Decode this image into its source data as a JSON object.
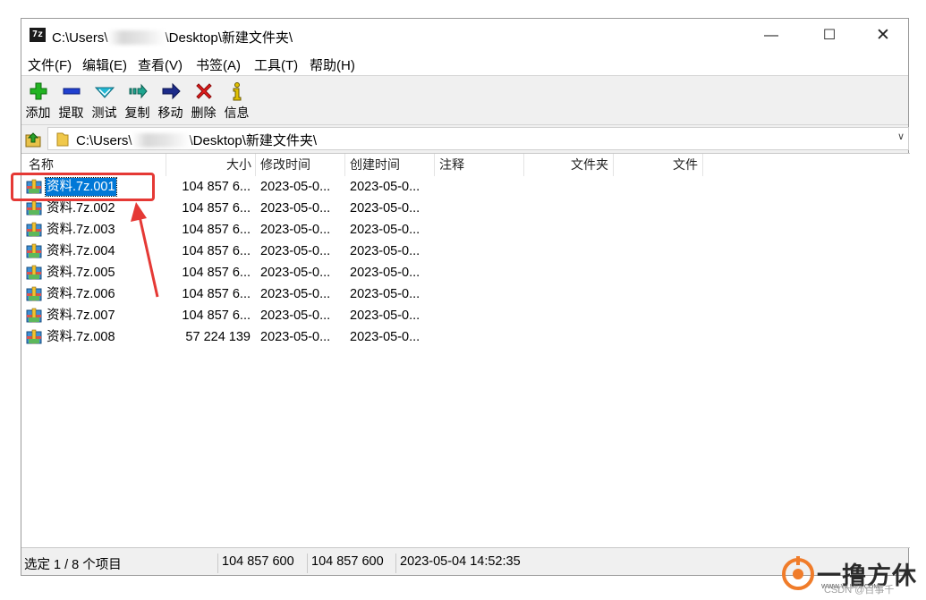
{
  "window": {
    "title_prefix": "C:\\Users\\",
    "title_suffix": "\\Desktop\\新建文件夹\\",
    "app_icon_text": "7z",
    "controls": {
      "minimize": "—",
      "maximize": "☐",
      "close": "✕"
    }
  },
  "menu": [
    "文件(F)",
    "编辑(E)",
    "查看(V)",
    "书签(A)",
    "工具(T)",
    "帮助(H)"
  ],
  "toolbar": [
    {
      "label": "添加",
      "icon": "add-plus-icon",
      "color": "#1ea81e"
    },
    {
      "label": "提取",
      "icon": "extract-minus-icon",
      "color": "#1a3bc7"
    },
    {
      "label": "测试",
      "icon": "test-check-icon",
      "color": "#19a9c4"
    },
    {
      "label": "复制",
      "icon": "copy-arrow-icon",
      "color": "#1c9c8c"
    },
    {
      "label": "移动",
      "icon": "move-arrow-icon",
      "color": "#1c2b8a"
    },
    {
      "label": "删除",
      "icon": "delete-x-icon",
      "color": "#e01818"
    },
    {
      "label": "信息",
      "icon": "info-icon",
      "color": "#d8b800"
    }
  ],
  "address": {
    "prefix": "C:\\Users\\",
    "suffix": "\\Desktop\\新建文件夹\\"
  },
  "columns": [
    "名称",
    "大小",
    "修改时间",
    "创建时间",
    "注释",
    "文件夹",
    "文件"
  ],
  "files": [
    {
      "name": "资料.7z.001",
      "size": "104 857 6...",
      "modified": "2023-05-0...",
      "created": "2023-05-0...",
      "selected": true
    },
    {
      "name": "资料.7z.002",
      "size": "104 857 6...",
      "modified": "2023-05-0...",
      "created": "2023-05-0..."
    },
    {
      "name": "资料.7z.003",
      "size": "104 857 6...",
      "modified": "2023-05-0...",
      "created": "2023-05-0..."
    },
    {
      "name": "资料.7z.004",
      "size": "104 857 6...",
      "modified": "2023-05-0...",
      "created": "2023-05-0..."
    },
    {
      "name": "资料.7z.005",
      "size": "104 857 6...",
      "modified": "2023-05-0...",
      "created": "2023-05-0..."
    },
    {
      "name": "资料.7z.006",
      "size": "104 857 6...",
      "modified": "2023-05-0...",
      "created": "2023-05-0..."
    },
    {
      "name": "资料.7z.007",
      "size": "104 857 6...",
      "modified": "2023-05-0...",
      "created": "2023-05-0..."
    },
    {
      "name": "资料.7z.008",
      "size": "57 224 139",
      "modified": "2023-05-0...",
      "created": "2023-05-0..."
    }
  ],
  "status": {
    "selection": "选定 1 / 8 个项目",
    "size": "104 857 600",
    "packed_size": "104 857 600",
    "date": "2023-05-04 14:52:35"
  },
  "watermark": {
    "text": "一撸方休",
    "url": "WWW.YILUFX.COM",
    "credit": "CSDN @百事千"
  },
  "colors": {
    "selection": "#0078d7",
    "annotation": "#e53935",
    "watermark_orange": "#f07c2a"
  }
}
